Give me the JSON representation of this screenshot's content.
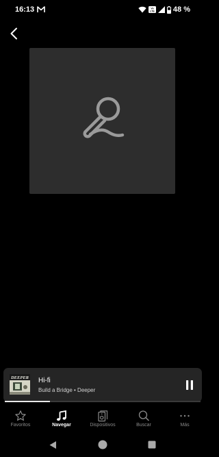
{
  "status_bar": {
    "time": "16:13",
    "battery": "48 %",
    "icons": [
      "gmail-icon",
      "wifi-icon",
      "volte-icon",
      "signal-icon",
      "battery-icon"
    ]
  },
  "artwork": {
    "placeholder_icon": "microphone-icon",
    "background_color": "#2d2d2d",
    "icon_color": "#9a9a9a"
  },
  "now_playing": {
    "title": "Hi-fi",
    "subtitle": "Build a Bridge • Deeper",
    "album_art_text": "DEEPER",
    "progress": 0.23,
    "state_icon": "pause-icon"
  },
  "bottom_nav": {
    "items": [
      {
        "label": "Favoritos",
        "icon": "star-icon",
        "active": false
      },
      {
        "label": "Navegar",
        "icon": "music-note-icon",
        "active": true
      },
      {
        "label": "Dispositivos",
        "icon": "speaker-icon",
        "active": false
      },
      {
        "label": "Buscar",
        "icon": "search-icon",
        "active": false
      },
      {
        "label": "Más",
        "icon": "more-icon",
        "active": false
      }
    ]
  },
  "colors": {
    "background": "#000000",
    "mini_player": "#252525",
    "inactive_label": "#8a8a8a",
    "active_label": "#ffffff"
  }
}
